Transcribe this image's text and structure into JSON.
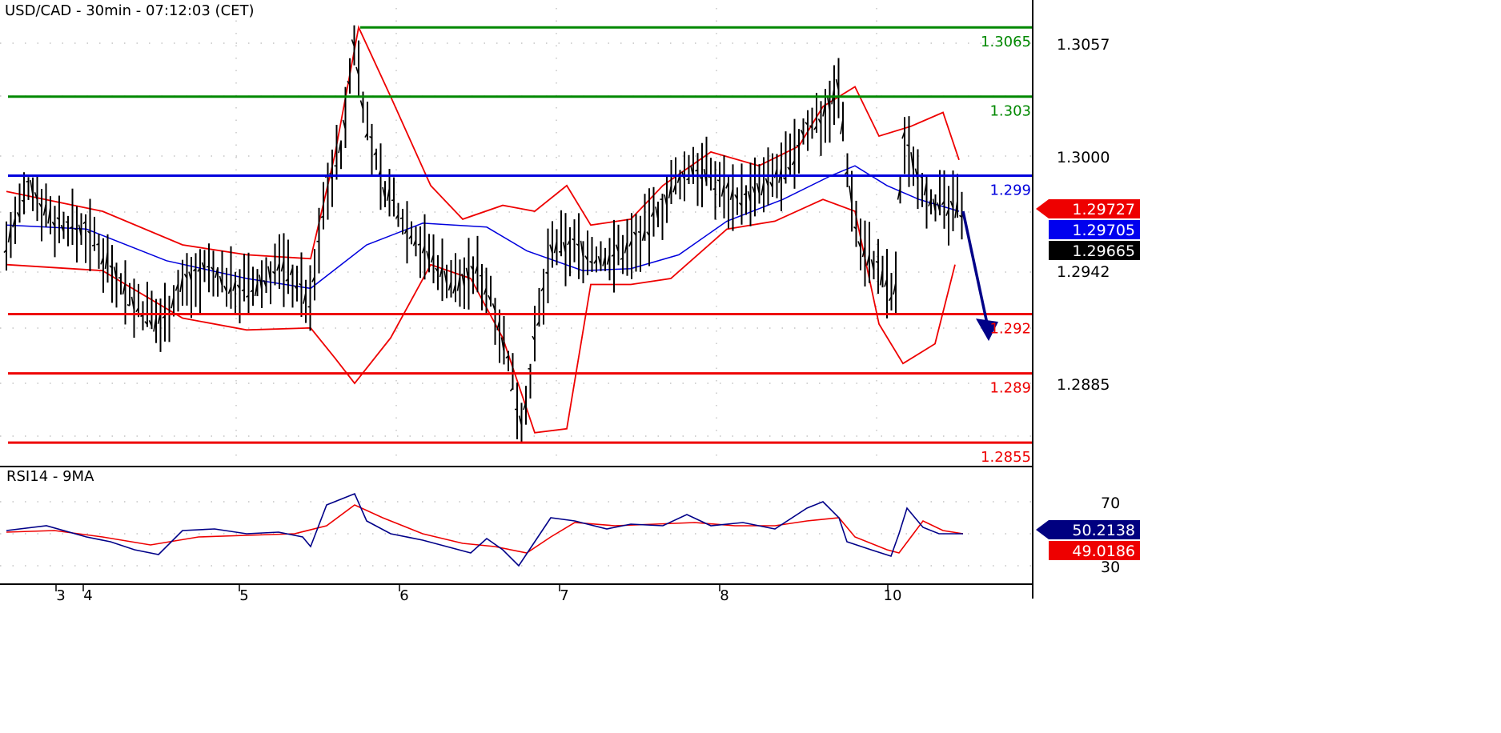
{
  "chart_data": [
    {
      "type": "line",
      "title": "USD/CAD - 30min - 07:12:03 (CET)",
      "y_ticks": [
        1.3057,
        1.3,
        1.2942,
        1.2885
      ],
      "y_range": [
        1.2855,
        1.3073
      ],
      "x_ticks": [
        "3",
        "4",
        "5",
        "6",
        "7",
        "8",
        "10"
      ],
      "levels": [
        {
          "label": "1.3065",
          "value": 1.3065,
          "color": "#008800",
          "kind": "resistance"
        },
        {
          "label": "1.303",
          "value": 1.303,
          "color": "#008800",
          "kind": "resistance"
        },
        {
          "label": "1.299",
          "value": 1.299,
          "color": "#0000dd",
          "kind": "pivot"
        },
        {
          "label": "1.292",
          "value": 1.292,
          "color": "#ee0000",
          "kind": "support"
        },
        {
          "label": "1.289",
          "value": 1.289,
          "color": "#ee0000",
          "kind": "support"
        },
        {
          "label": "1.2855",
          "value": 1.2855,
          "color": "#ee0000",
          "kind": "support"
        }
      ],
      "price_tags": [
        {
          "label": "1.29727",
          "value": 1.29727,
          "color": "#ee0000",
          "pointer": true
        },
        {
          "label": "1.29705",
          "value": 1.29705,
          "color": "#0000ee",
          "pointer": false
        },
        {
          "label": "1.29665",
          "value": 1.29665,
          "color": "#000000",
          "pointer": false
        }
      ],
      "price_path": [
        [
          0,
          1.2955
        ],
        [
          0.3,
          1.2985
        ],
        [
          0.6,
          1.2967
        ],
        [
          1.0,
          1.2962
        ],
        [
          1.3,
          1.2945
        ],
        [
          1.6,
          1.2925
        ],
        [
          1.9,
          1.2915
        ],
        [
          2.2,
          1.2935
        ],
        [
          2.5,
          1.2942
        ],
        [
          2.8,
          1.2935
        ],
        [
          3.1,
          1.2932
        ],
        [
          3.4,
          1.2945
        ],
        [
          3.6,
          1.2938
        ],
        [
          3.8,
          1.2925
        ],
        [
          4.0,
          1.2985
        ],
        [
          4.2,
          1.3005
        ],
        [
          4.35,
          1.306
        ],
        [
          4.5,
          1.3015
        ],
        [
          4.7,
          1.2985
        ],
        [
          5.0,
          1.2965
        ],
        [
          5.3,
          1.2948
        ],
        [
          5.6,
          1.2935
        ],
        [
          5.9,
          1.2942
        ],
        [
          6.1,
          1.2925
        ],
        [
          6.3,
          1.289
        ],
        [
          6.45,
          1.2865
        ],
        [
          6.6,
          1.2905
        ],
        [
          6.8,
          1.2952
        ],
        [
          7.1,
          1.2955
        ],
        [
          7.4,
          1.2947
        ],
        [
          7.7,
          1.2952
        ],
        [
          8.0,
          1.2962
        ],
        [
          8.3,
          1.2982
        ],
        [
          8.6,
          1.2995
        ],
        [
          8.9,
          1.2985
        ],
        [
          9.2,
          1.2978
        ],
        [
          9.5,
          1.2985
        ],
        [
          9.8,
          1.2995
        ],
        [
          10.0,
          1.3015
        ],
        [
          10.2,
          1.302
        ],
        [
          10.4,
          1.3035
        ],
        [
          10.5,
          1.2995
        ],
        [
          10.65,
          1.2958
        ],
        [
          10.8,
          1.2948
        ],
        [
          11.0,
          1.2935
        ],
        [
          11.1,
          1.2925
        ],
        [
          11.2,
          1.301
        ],
        [
          11.35,
          1.2995
        ],
        [
          11.55,
          1.2978
        ],
        [
          11.75,
          1.2972
        ],
        [
          11.95,
          1.2974
        ]
      ],
      "ma_path": [
        [
          0,
          1.2965
        ],
        [
          1.0,
          1.2963
        ],
        [
          2.0,
          1.2947
        ],
        [
          3.0,
          1.2938
        ],
        [
          3.8,
          1.2933
        ],
        [
          4.5,
          1.2955
        ],
        [
          5.2,
          1.2966
        ],
        [
          6.0,
          1.2964
        ],
        [
          6.5,
          1.2952
        ],
        [
          7.2,
          1.2942
        ],
        [
          7.8,
          1.2943
        ],
        [
          8.4,
          1.295
        ],
        [
          9.0,
          1.2967
        ],
        [
          9.7,
          1.2978
        ],
        [
          10.3,
          1.299
        ],
        [
          10.6,
          1.2995
        ],
        [
          11.0,
          1.2985
        ],
        [
          11.4,
          1.2978
        ],
        [
          11.9,
          1.2972
        ]
      ],
      "bb_upper": [
        [
          0,
          1.2982
        ],
        [
          1.2,
          1.2972
        ],
        [
          2.2,
          1.2955
        ],
        [
          3.0,
          1.295
        ],
        [
          3.8,
          1.2948
        ],
        [
          4.1,
          1.3
        ],
        [
          4.4,
          1.3065
        ],
        [
          4.8,
          1.303
        ],
        [
          5.3,
          1.2985
        ],
        [
          5.7,
          1.2968
        ],
        [
          6.2,
          1.2975
        ],
        [
          6.6,
          1.2972
        ],
        [
          7.0,
          1.2985
        ],
        [
          7.3,
          1.2965
        ],
        [
          7.8,
          1.2968
        ],
        [
          8.2,
          1.2985
        ],
        [
          8.8,
          1.3002
        ],
        [
          9.4,
          1.2995
        ],
        [
          9.9,
          1.3005
        ],
        [
          10.2,
          1.3025
        ],
        [
          10.6,
          1.3035
        ],
        [
          10.9,
          1.301
        ],
        [
          11.3,
          1.3015
        ],
        [
          11.7,
          1.3022
        ],
        [
          11.9,
          1.2998
        ]
      ],
      "bb_lower": [
        [
          0,
          1.2945
        ],
        [
          1.2,
          1.2942
        ],
        [
          2.2,
          1.2918
        ],
        [
          3.0,
          1.2912
        ],
        [
          3.8,
          1.2913
        ],
        [
          4.1,
          1.2898
        ],
        [
          4.35,
          1.2885
        ],
        [
          4.8,
          1.2908
        ],
        [
          5.3,
          1.2945
        ],
        [
          5.8,
          1.2938
        ],
        [
          6.2,
          1.2908
        ],
        [
          6.6,
          1.286
        ],
        [
          7.0,
          1.2862
        ],
        [
          7.3,
          1.2935
        ],
        [
          7.8,
          1.2935
        ],
        [
          8.3,
          1.2938
        ],
        [
          9.0,
          1.2963
        ],
        [
          9.6,
          1.2967
        ],
        [
          10.2,
          1.2978
        ],
        [
          10.6,
          1.2972
        ],
        [
          10.9,
          1.2915
        ],
        [
          11.2,
          1.2895
        ],
        [
          11.6,
          1.2905
        ],
        [
          11.85,
          1.2945
        ]
      ],
      "forecast_arrow": {
        "from": [
          11.95,
          1.2972
        ],
        "to": [
          12.25,
          1.2908
        ],
        "color": "#000088"
      }
    },
    {
      "type": "line",
      "title": "RSI14 - 9MA",
      "y_ticks": [
        70,
        30
      ],
      "y_range": [
        20,
        80
      ],
      "price_tags": [
        {
          "label": "50.2138",
          "value": 50.2138,
          "color": "#000080",
          "pointer": true
        },
        {
          "label": "49.0186",
          "value": 49.0186,
          "color": "#ee0000",
          "pointer": false
        }
      ],
      "series": [
        {
          "name": "RSI14",
          "color": "#000088",
          "values": [
            [
              0,
              52
            ],
            [
              0.5,
              55
            ],
            [
              1.0,
              48
            ],
            [
              1.3,
              45
            ],
            [
              1.6,
              40
            ],
            [
              1.9,
              37
            ],
            [
              2.2,
              52
            ],
            [
              2.6,
              53
            ],
            [
              3.0,
              50
            ],
            [
              3.4,
              51
            ],
            [
              3.7,
              48
            ],
            [
              3.8,
              42
            ],
            [
              4.0,
              68
            ],
            [
              4.2,
              72
            ],
            [
              4.35,
              75
            ],
            [
              4.5,
              58
            ],
            [
              4.8,
              50
            ],
            [
              5.2,
              46
            ],
            [
              5.5,
              42
            ],
            [
              5.8,
              38
            ],
            [
              6.0,
              47
            ],
            [
              6.2,
              40
            ],
            [
              6.4,
              30
            ],
            [
              6.6,
              45
            ],
            [
              6.8,
              60
            ],
            [
              7.1,
              58
            ],
            [
              7.5,
              53
            ],
            [
              7.8,
              56
            ],
            [
              8.2,
              55
            ],
            [
              8.5,
              62
            ],
            [
              8.8,
              55
            ],
            [
              9.2,
              57
            ],
            [
              9.6,
              53
            ],
            [
              10.0,
              66
            ],
            [
              10.2,
              70
            ],
            [
              10.4,
              60
            ],
            [
              10.5,
              45
            ],
            [
              10.8,
              40
            ],
            [
              11.05,
              36
            ],
            [
              11.15,
              50
            ],
            [
              11.25,
              66
            ],
            [
              11.45,
              54
            ],
            [
              11.65,
              50
            ],
            [
              11.95,
              50
            ]
          ]
        },
        {
          "name": "9MA",
          "color": "#ee0000",
          "values": [
            [
              0,
              51
            ],
            [
              0.6,
              52
            ],
            [
              1.2,
              48
            ],
            [
              1.8,
              43
            ],
            [
              2.4,
              48
            ],
            [
              3.0,
              49
            ],
            [
              3.6,
              50
            ],
            [
              4.0,
              55
            ],
            [
              4.35,
              68
            ],
            [
              4.7,
              60
            ],
            [
              5.2,
              50
            ],
            [
              5.7,
              44
            ],
            [
              6.1,
              42
            ],
            [
              6.5,
              38
            ],
            [
              6.8,
              48
            ],
            [
              7.1,
              57
            ],
            [
              7.6,
              55
            ],
            [
              8.1,
              56
            ],
            [
              8.6,
              57
            ],
            [
              9.1,
              55
            ],
            [
              9.6,
              55
            ],
            [
              10.0,
              58
            ],
            [
              10.4,
              60
            ],
            [
              10.6,
              48
            ],
            [
              11.0,
              40
            ],
            [
              11.15,
              38
            ],
            [
              11.45,
              58
            ],
            [
              11.7,
              52
            ],
            [
              11.95,
              50
            ]
          ]
        }
      ]
    }
  ]
}
